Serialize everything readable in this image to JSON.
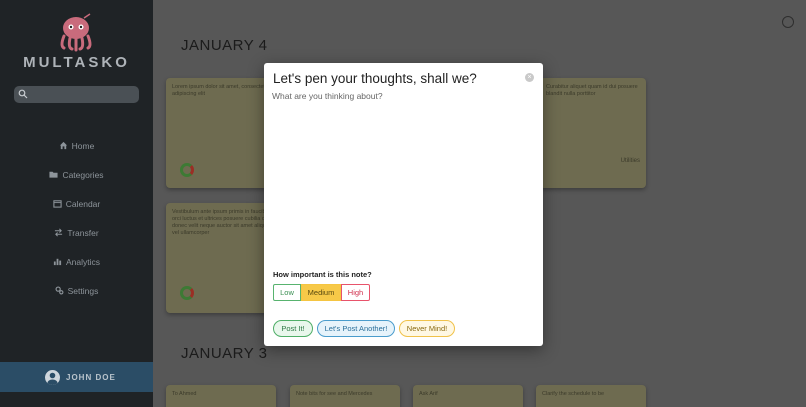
{
  "app": {
    "brand": "MULTASKO"
  },
  "sidebar": {
    "search_placeholder": "",
    "items": [
      {
        "label": "Home",
        "icon": "home-icon"
      },
      {
        "label": "Categories",
        "icon": "folder-icon"
      },
      {
        "label": "Calendar",
        "icon": "calendar-icon"
      },
      {
        "label": "Transfer",
        "icon": "transfer-icon"
      },
      {
        "label": "Analytics",
        "icon": "bar-chart-icon"
      },
      {
        "label": "Settings",
        "icon": "gears-icon"
      }
    ],
    "user_name": "JOHN DOE"
  },
  "main": {
    "headings": [
      "JANUARY 4",
      "JANUARY 3"
    ],
    "cards_jan4": [
      {
        "text": "Lorem ipsum dolor sit amet, consectetur adipiscing elit",
        "badge": ""
      },
      {
        "text": "Curabitur aliquet quam id dui posuere blandit nulla porttitor",
        "badge": "Utilities"
      },
      {
        "text": "Vestibulum ante ipsum primis in faucibus orci luctus et ultrices posuere cubilia curae; donec velit neque auctor sit amet aliquam vel ullamcorper",
        "badge": ""
      }
    ],
    "cards_jan3": [
      {
        "text": "To Ahmed"
      },
      {
        "text": "Note bits for see and Mercedes"
      },
      {
        "text": "Ask Arif"
      },
      {
        "text": "Clarify the schedule to be"
      }
    ]
  },
  "modal": {
    "title": "Let's pen your thoughts, shall we?",
    "close_symbol": "×",
    "note_placeholder": "What are you thinking about?",
    "note_value": "",
    "priority_label": "How important is this note?",
    "priority_options": [
      "Low",
      "Medium",
      "High"
    ],
    "priority_selected": "Medium",
    "buttons": {
      "post": "Post It!",
      "another": "Let's Post Another!",
      "never": "Never Mind!"
    }
  },
  "colors": {
    "low": "#58b36f",
    "medium": "#f7c948",
    "high": "#e8536b",
    "post": "#4fae67",
    "another": "#4a9ccc",
    "never": "#f0c24a",
    "sidebar_bg": "#1f2326",
    "user_bar": "#2b4d66"
  }
}
